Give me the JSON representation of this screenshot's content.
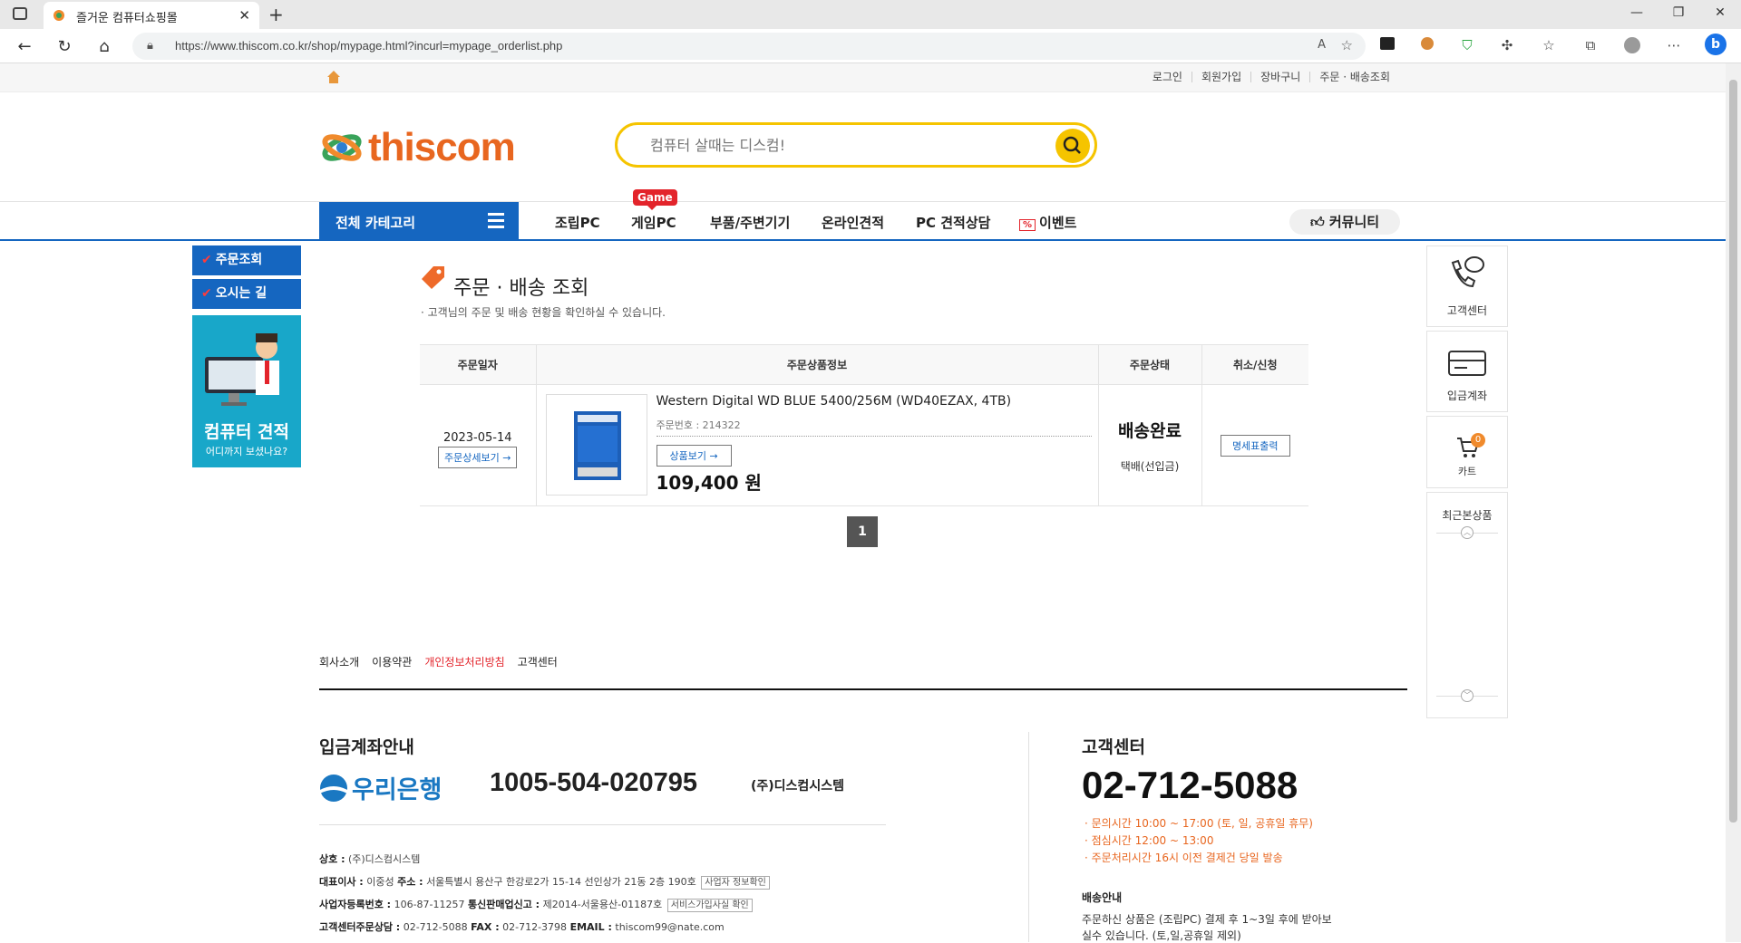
{
  "browser": {
    "tab_title": "즐거운 컴퓨터쇼핑몰",
    "url": "https://www.thiscom.co.kr/shop/mypage.html?incurl=mypage_orderlist.php"
  },
  "util_links": [
    "로그인",
    "회원가입",
    "장바구니",
    "주문 · 배송조회"
  ],
  "header": {
    "logo_text": "thiscom",
    "search_placeholder": "컴퓨터 살때는 디스컴!"
  },
  "gnb": {
    "all_category": "전체 카테고리",
    "menus": [
      "조립PC",
      "게임PC",
      "부품/주변기기",
      "온라인견적",
      "PC 견적상담",
      "이벤트"
    ],
    "game_badge": "Game",
    "event_badge": "%",
    "community": "커뮤니티"
  },
  "left_sidebar": {
    "order_check": "주문조회",
    "directions": "오시는 길",
    "banner_title": "컴퓨터 견적",
    "banner_sub": "어디까지 보셨나요?"
  },
  "right_sidebar": {
    "customer_center": "고객센터",
    "deposit_account": "입금계좌",
    "cart": "카트",
    "cart_count": "0",
    "recent_items": "최근본상품"
  },
  "main": {
    "title": "주문 · 배송 조회",
    "description": "· 고객님의 주문 및 배송 현황을 확인하실 수 있습니다.",
    "columns": [
      "주문일자",
      "주문상품정보",
      "주문상태",
      "취소/신청"
    ],
    "order": {
      "date": "2023-05-14",
      "detail_button": "주문상세보기 →",
      "product_name": "Western Digital WD BLUE 5400/256M (WD40EZAX, 4TB)",
      "order_no": "주문번호 : 214322",
      "view_button": "상품보기 →",
      "price": "109,400 원",
      "status": "배송완료",
      "shipping": "택배(선입금)",
      "invoice_button": "명세표출력"
    },
    "page": "1"
  },
  "footer": {
    "links": [
      "회사소개",
      "이용약관",
      "개인정보처리방침",
      "고객센터"
    ],
    "deposit_title": "입금계좌안내",
    "bank_name": "우리은행",
    "account_number": "1005-504-020795",
    "account_holder": "(주)디스컴시스템",
    "company_label": "상호 :",
    "company_value": "(주)디스컴시스템",
    "ceo_label": "대표이사 :",
    "ceo_value": "이중성",
    "address_label": "주소 :",
    "address_value": "서울특별시 용산구 한강로2가 15-14 선인상가 21동 2층 190호",
    "biz_info_tag": "사업자 정보확인",
    "biz_reg_label": "사업자등록번호 :",
    "biz_reg_value": "106-87-11257",
    "mail_order_label": "통신판매업신고 :",
    "mail_order_value": "제2014-서울용산-01187호",
    "service_tag": "서비스가입사실 확인",
    "cs_label": "고객센터주문상담 :",
    "cs_value": "02-712-5088",
    "fax_label": "FAX :",
    "fax_value": "02-712-3798",
    "email_label": "EMAIL :",
    "email_value": "thiscom99@nate.com",
    "cs_title": "고객센터",
    "cs_phone": "02-712-5088",
    "cs_hours": [
      "· 문의시간 10:00 ~ 17:00 (토, 일, 공휴일 휴무)",
      "· 점심시간 12:00 ~ 13:00",
      "· 주문처리시간 16시 이전 결제건 당일 발송"
    ],
    "delivery_title": "배송안내",
    "delivery_text_1": "주문하신 상품은 (조립PC) 결제 후 1~3일 후에 받아보",
    "delivery_text_2": "실수 있습니다. (토,일,공휴일 제외)"
  },
  "colors": {
    "brand_blue": "#1566c0",
    "brand_orange": "#e8661f",
    "search_yellow": "#f5c400"
  }
}
